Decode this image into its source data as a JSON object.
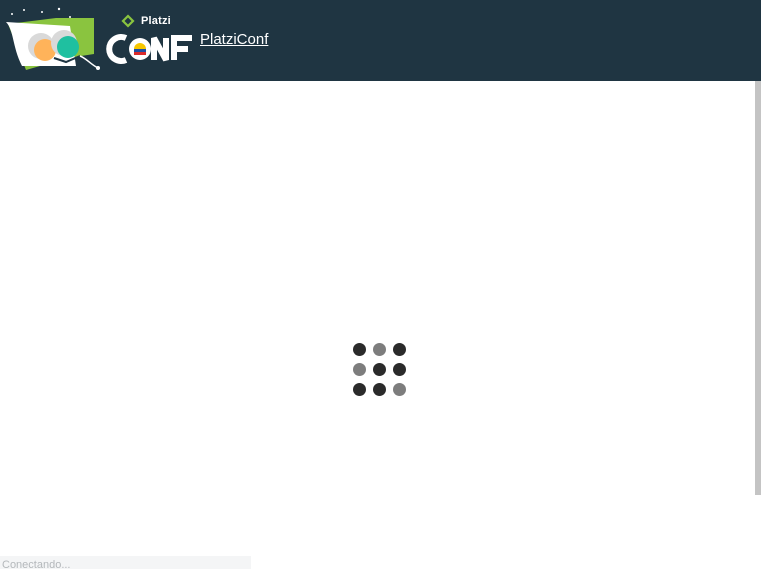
{
  "header": {
    "brand_small": "Platzi",
    "brand_link": "PlatziConf",
    "logo_icon": "platzi-conf-logo",
    "colors": {
      "background": "#1f3542",
      "accent_green": "#8ac43f",
      "accent_orange": "#ffb35a",
      "accent_teal": "#1fc0a0",
      "accent_yellow": "#f6c600",
      "accent_blue": "#1f4fa3",
      "accent_red": "#d92b2b"
    }
  },
  "loader": {
    "icon": "loading-spinner-icon",
    "colors": {
      "dark": "#2b2b2b",
      "dim": "#7d7d7d"
    }
  },
  "status_bar": {
    "text": "Conectando..."
  }
}
